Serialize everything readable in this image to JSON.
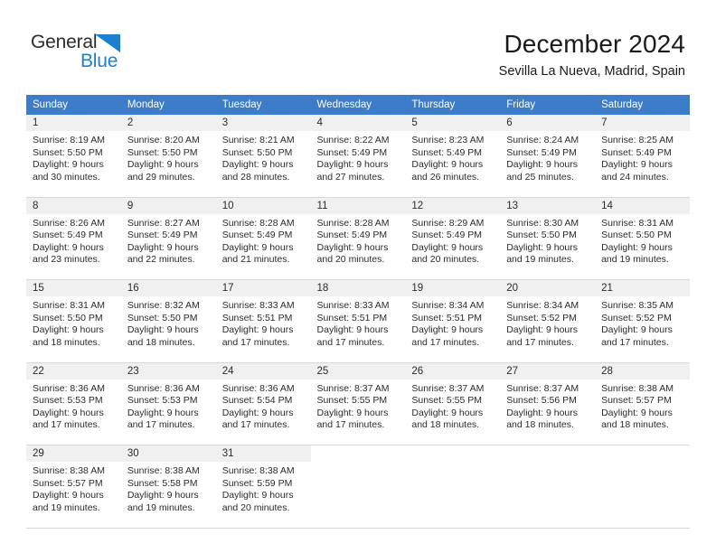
{
  "brand": {
    "name_part1": "General",
    "name_part2": "Blue",
    "triangle_color": "#1c7fd0",
    "text_color": "#2b2b2b"
  },
  "header": {
    "title": "December 2024",
    "location": "Sevilla La Nueva, Madrid, Spain"
  },
  "theme": {
    "header_bg": "#3d7cc9",
    "header_text": "#ffffff",
    "daynum_bg": "#f0f0f0",
    "cell_bg": "#ffffff",
    "separator": "#d8d8d8"
  },
  "weekday_headers": [
    "Sunday",
    "Monday",
    "Tuesday",
    "Wednesday",
    "Thursday",
    "Friday",
    "Saturday"
  ],
  "weeks": [
    {
      "days": [
        {
          "num": "1",
          "sunrise": "Sunrise: 8:19 AM",
          "sunset": "Sunset: 5:50 PM",
          "daylight1": "Daylight: 9 hours",
          "daylight2": "and 30 minutes."
        },
        {
          "num": "2",
          "sunrise": "Sunrise: 8:20 AM",
          "sunset": "Sunset: 5:50 PM",
          "daylight1": "Daylight: 9 hours",
          "daylight2": "and 29 minutes."
        },
        {
          "num": "3",
          "sunrise": "Sunrise: 8:21 AM",
          "sunset": "Sunset: 5:50 PM",
          "daylight1": "Daylight: 9 hours",
          "daylight2": "and 28 minutes."
        },
        {
          "num": "4",
          "sunrise": "Sunrise: 8:22 AM",
          "sunset": "Sunset: 5:49 PM",
          "daylight1": "Daylight: 9 hours",
          "daylight2": "and 27 minutes."
        },
        {
          "num": "5",
          "sunrise": "Sunrise: 8:23 AM",
          "sunset": "Sunset: 5:49 PM",
          "daylight1": "Daylight: 9 hours",
          "daylight2": "and 26 minutes."
        },
        {
          "num": "6",
          "sunrise": "Sunrise: 8:24 AM",
          "sunset": "Sunset: 5:49 PM",
          "daylight1": "Daylight: 9 hours",
          "daylight2": "and 25 minutes."
        },
        {
          "num": "7",
          "sunrise": "Sunrise: 8:25 AM",
          "sunset": "Sunset: 5:49 PM",
          "daylight1": "Daylight: 9 hours",
          "daylight2": "and 24 minutes."
        }
      ]
    },
    {
      "days": [
        {
          "num": "8",
          "sunrise": "Sunrise: 8:26 AM",
          "sunset": "Sunset: 5:49 PM",
          "daylight1": "Daylight: 9 hours",
          "daylight2": "and 23 minutes."
        },
        {
          "num": "9",
          "sunrise": "Sunrise: 8:27 AM",
          "sunset": "Sunset: 5:49 PM",
          "daylight1": "Daylight: 9 hours",
          "daylight2": "and 22 minutes."
        },
        {
          "num": "10",
          "sunrise": "Sunrise: 8:28 AM",
          "sunset": "Sunset: 5:49 PM",
          "daylight1": "Daylight: 9 hours",
          "daylight2": "and 21 minutes."
        },
        {
          "num": "11",
          "sunrise": "Sunrise: 8:28 AM",
          "sunset": "Sunset: 5:49 PM",
          "daylight1": "Daylight: 9 hours",
          "daylight2": "and 20 minutes."
        },
        {
          "num": "12",
          "sunrise": "Sunrise: 8:29 AM",
          "sunset": "Sunset: 5:49 PM",
          "daylight1": "Daylight: 9 hours",
          "daylight2": "and 20 minutes."
        },
        {
          "num": "13",
          "sunrise": "Sunrise: 8:30 AM",
          "sunset": "Sunset: 5:50 PM",
          "daylight1": "Daylight: 9 hours",
          "daylight2": "and 19 minutes."
        },
        {
          "num": "14",
          "sunrise": "Sunrise: 8:31 AM",
          "sunset": "Sunset: 5:50 PM",
          "daylight1": "Daylight: 9 hours",
          "daylight2": "and 19 minutes."
        }
      ]
    },
    {
      "days": [
        {
          "num": "15",
          "sunrise": "Sunrise: 8:31 AM",
          "sunset": "Sunset: 5:50 PM",
          "daylight1": "Daylight: 9 hours",
          "daylight2": "and 18 minutes."
        },
        {
          "num": "16",
          "sunrise": "Sunrise: 8:32 AM",
          "sunset": "Sunset: 5:50 PM",
          "daylight1": "Daylight: 9 hours",
          "daylight2": "and 18 minutes."
        },
        {
          "num": "17",
          "sunrise": "Sunrise: 8:33 AM",
          "sunset": "Sunset: 5:51 PM",
          "daylight1": "Daylight: 9 hours",
          "daylight2": "and 17 minutes."
        },
        {
          "num": "18",
          "sunrise": "Sunrise: 8:33 AM",
          "sunset": "Sunset: 5:51 PM",
          "daylight1": "Daylight: 9 hours",
          "daylight2": "and 17 minutes."
        },
        {
          "num": "19",
          "sunrise": "Sunrise: 8:34 AM",
          "sunset": "Sunset: 5:51 PM",
          "daylight1": "Daylight: 9 hours",
          "daylight2": "and 17 minutes."
        },
        {
          "num": "20",
          "sunrise": "Sunrise: 8:34 AM",
          "sunset": "Sunset: 5:52 PM",
          "daylight1": "Daylight: 9 hours",
          "daylight2": "and 17 minutes."
        },
        {
          "num": "21",
          "sunrise": "Sunrise: 8:35 AM",
          "sunset": "Sunset: 5:52 PM",
          "daylight1": "Daylight: 9 hours",
          "daylight2": "and 17 minutes."
        }
      ]
    },
    {
      "days": [
        {
          "num": "22",
          "sunrise": "Sunrise: 8:36 AM",
          "sunset": "Sunset: 5:53 PM",
          "daylight1": "Daylight: 9 hours",
          "daylight2": "and 17 minutes."
        },
        {
          "num": "23",
          "sunrise": "Sunrise: 8:36 AM",
          "sunset": "Sunset: 5:53 PM",
          "daylight1": "Daylight: 9 hours",
          "daylight2": "and 17 minutes."
        },
        {
          "num": "24",
          "sunrise": "Sunrise: 8:36 AM",
          "sunset": "Sunset: 5:54 PM",
          "daylight1": "Daylight: 9 hours",
          "daylight2": "and 17 minutes."
        },
        {
          "num": "25",
          "sunrise": "Sunrise: 8:37 AM",
          "sunset": "Sunset: 5:55 PM",
          "daylight1": "Daylight: 9 hours",
          "daylight2": "and 17 minutes."
        },
        {
          "num": "26",
          "sunrise": "Sunrise: 8:37 AM",
          "sunset": "Sunset: 5:55 PM",
          "daylight1": "Daylight: 9 hours",
          "daylight2": "and 18 minutes."
        },
        {
          "num": "27",
          "sunrise": "Sunrise: 8:37 AM",
          "sunset": "Sunset: 5:56 PM",
          "daylight1": "Daylight: 9 hours",
          "daylight2": "and 18 minutes."
        },
        {
          "num": "28",
          "sunrise": "Sunrise: 8:38 AM",
          "sunset": "Sunset: 5:57 PM",
          "daylight1": "Daylight: 9 hours",
          "daylight2": "and 18 minutes."
        }
      ]
    },
    {
      "days": [
        {
          "num": "29",
          "sunrise": "Sunrise: 8:38 AM",
          "sunset": "Sunset: 5:57 PM",
          "daylight1": "Daylight: 9 hours",
          "daylight2": "and 19 minutes."
        },
        {
          "num": "30",
          "sunrise": "Sunrise: 8:38 AM",
          "sunset": "Sunset: 5:58 PM",
          "daylight1": "Daylight: 9 hours",
          "daylight2": "and 19 minutes."
        },
        {
          "num": "31",
          "sunrise": "Sunrise: 8:38 AM",
          "sunset": "Sunset: 5:59 PM",
          "daylight1": "Daylight: 9 hours",
          "daylight2": "and 20 minutes."
        },
        {
          "num": "",
          "sunrise": "",
          "sunset": "",
          "daylight1": "",
          "daylight2": ""
        },
        {
          "num": "",
          "sunrise": "",
          "sunset": "",
          "daylight1": "",
          "daylight2": ""
        },
        {
          "num": "",
          "sunrise": "",
          "sunset": "",
          "daylight1": "",
          "daylight2": ""
        },
        {
          "num": "",
          "sunrise": "",
          "sunset": "",
          "daylight1": "",
          "daylight2": ""
        }
      ]
    }
  ]
}
